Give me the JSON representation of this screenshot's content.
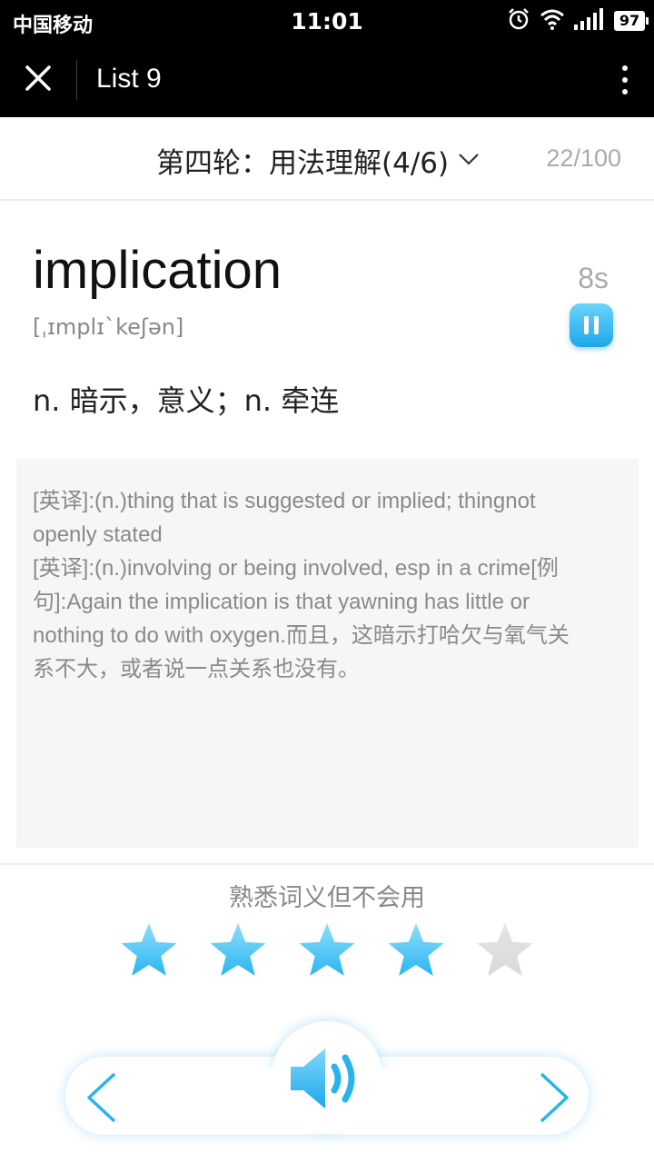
{
  "status_bar": {
    "carrier": "中国移动",
    "time": "11:01",
    "battery": "97",
    "icons": [
      "alarm-icon",
      "wifi-icon",
      "signal-icon",
      "battery-icon"
    ]
  },
  "app_bar": {
    "title": "List 9",
    "close_icon": "close-icon",
    "more_icon": "more-vertical-icon"
  },
  "round": {
    "label": "第四轮：用法理解(4/6)",
    "progress": "22/100"
  },
  "word": {
    "text": "implication",
    "phonetic": "[ˌɪmplɪˋkeʃən]",
    "meaning": "n. 暗示，意义；n. 牵连",
    "timer": "8s"
  },
  "definition": {
    "lines": [
      "[英译]:(n.)thing that is suggested or implied; thingnot",
      "openly stated",
      "[英译]:(n.)involving or being involved, esp in a crime[例",
      "句]:Again the implication is that yawning has little or",
      "nothing to do with oxygen.而且，这暗示打哈欠与氧气关",
      "系不大，或者说一点关系也没有。"
    ]
  },
  "familiarity": {
    "label": "熟悉词义但不会用",
    "rating": 4,
    "max": 5
  },
  "colors": {
    "accent": "#29b3ee",
    "star_active": "#2bb5f0",
    "star_inactive": "#d9d9d9",
    "muted_text": "#8a8a8a"
  }
}
